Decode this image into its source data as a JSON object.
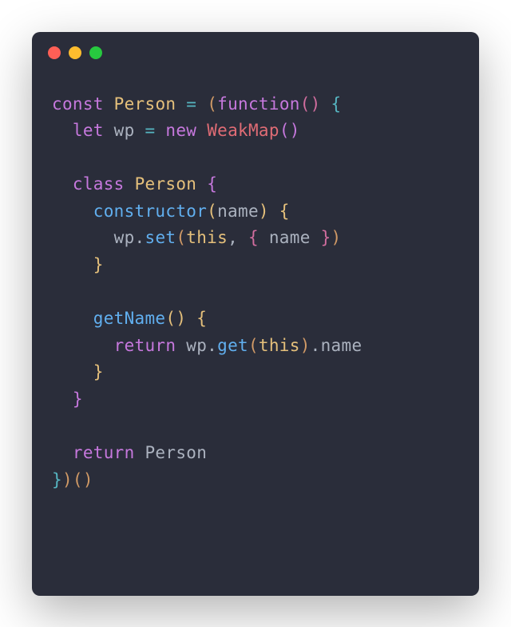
{
  "colors": {
    "background": "#2a2d3a",
    "red": "#ff5f56",
    "yellow": "#ffbd2e",
    "green": "#27c93f"
  },
  "code": {
    "line1": {
      "t1": "const",
      "t2": "Person",
      "t3": "=",
      "t4": "(",
      "t5": "function",
      "t6": "(",
      "t7": ")",
      "t8": " {"
    },
    "line2": {
      "t1": "  let",
      "t2": "wp",
      "t3": "=",
      "t4": "new",
      "t5": "WeakMap",
      "t6": "(",
      "t7": ")"
    },
    "line3": {
      "t1": ""
    },
    "line4": {
      "t1": "  class",
      "t2": "Person",
      "t3": "{"
    },
    "line5": {
      "t1": "    constructor",
      "t2": "(",
      "t3": "name",
      "t4": ")",
      "t5": " {"
    },
    "line6": {
      "t1": "      wp",
      "t2": ".",
      "t3": "set",
      "t4": "(",
      "t5": "this",
      "t6": ", ",
      "t7": "{",
      "t8": " name ",
      "t9": "}",
      "t10": ")"
    },
    "line7": {
      "t1": "    }"
    },
    "line8": {
      "t1": ""
    },
    "line9": {
      "t1": "    getName",
      "t2": "(",
      "t3": ")",
      "t4": " {"
    },
    "line10": {
      "t1": "      return",
      "t2": " wp",
      "t3": ".",
      "t4": "get",
      "t5": "(",
      "t6": "this",
      "t7": ")",
      "t8": ".",
      "t9": "name"
    },
    "line11": {
      "t1": "    }"
    },
    "line12": {
      "t1": "  }"
    },
    "line13": {
      "t1": ""
    },
    "line14": {
      "t1": "  return",
      "t2": " Person"
    },
    "line15": {
      "t1": "}",
      "t2": ")",
      "t3": "(",
      "t4": ")"
    }
  }
}
